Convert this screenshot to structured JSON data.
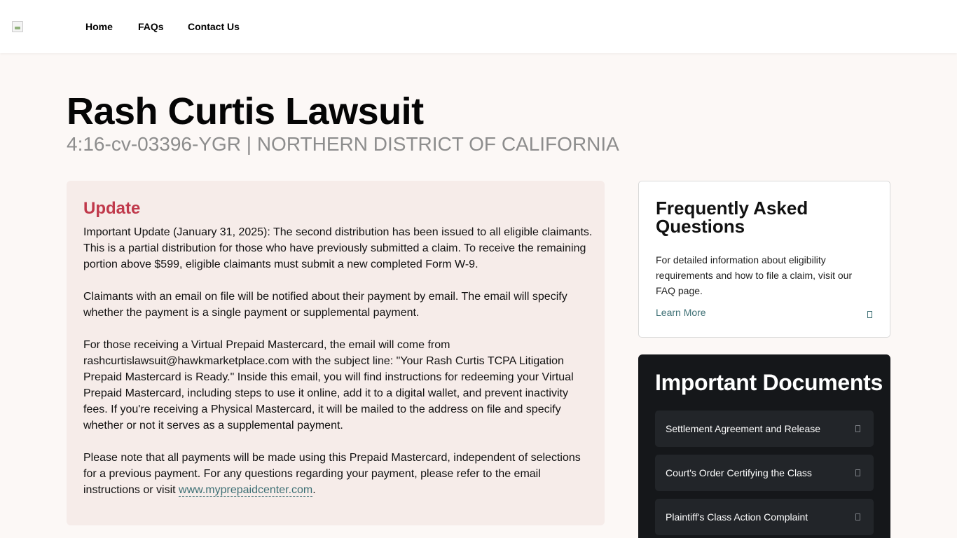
{
  "header": {
    "nav": [
      {
        "label": "Home"
      },
      {
        "label": "FAQs"
      },
      {
        "label": "Contact Us"
      }
    ]
  },
  "page": {
    "title": "Rash Curtis Lawsuit",
    "subtitle": "4:16-cv-03396-YGR | NORTHERN DISTRICT OF CALIFORNIA"
  },
  "update": {
    "title": "Update",
    "paragraphs": [
      "Important Update (January 31, 2025): The second distribution has been issued to all eligible claimants. This is a partial distribution for those who have previously submitted a claim. To receive the remaining portion above $599, eligible claimants must submit a new completed Form W-9.",
      "Claimants with an email on file will be notified about their payment by email. The email will specify whether the payment is a single payment or supplemental payment.",
      "For those receiving a Virtual Prepaid Mastercard, the email will come from rashcurtislawsuit@hawkmarketplace.com with the subject line: \"Your Rash Curtis TCPA Litigation Prepaid Mastercard is Ready.\" Inside this email, you will find instructions for redeeming your Virtual Prepaid Mastercard, including steps to use it online, add it to a digital wallet, and prevent inactivity fees. If you're receiving a Physical Mastercard, it will be mailed to the address on file and specify whether or not it serves as a supplemental payment.",
      "Please note that all payments will be made using this Prepaid Mastercard, independent of selections for a previous payment. For any questions regarding your payment, please refer to the email instructions or visit"
    ],
    "link_text": "www.myprepaidcenter.com",
    "link_suffix": "."
  },
  "faq": {
    "title": "Frequently Asked Questions",
    "description": "For detailed information about eligibility requirements and how to file a claim, visit our FAQ page.",
    "link_label": "Learn More"
  },
  "documents": {
    "title": "Important Documents",
    "items": [
      {
        "label": "Settlement Agreement and Release"
      },
      {
        "label": "Court's Order Certifying the Class"
      },
      {
        "label": "Plaintiff's Class Action Complaint"
      }
    ]
  },
  "colors": {
    "accent_red": "#c0394b",
    "link_teal": "#3d6f74",
    "page_bg": "#fcf8f6",
    "docs_bg": "#15171a"
  }
}
